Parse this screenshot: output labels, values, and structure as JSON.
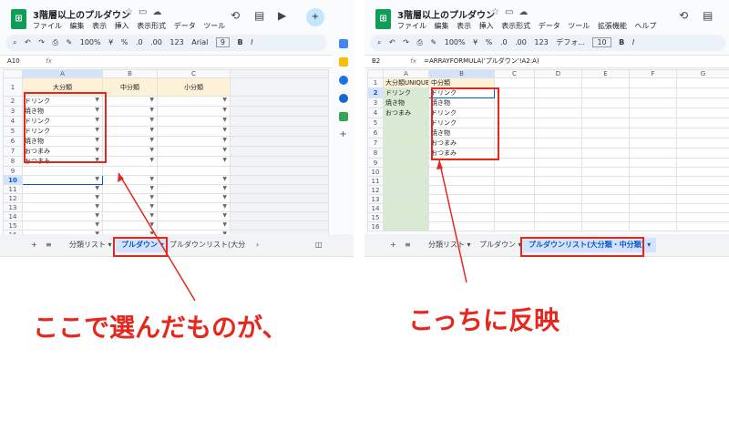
{
  "left": {
    "title": "3階層以上のプルダウン",
    "menu": [
      "ファイル",
      "編集",
      "表示",
      "挿入",
      "表示形式",
      "データ",
      "ツール"
    ],
    "toolbar": [
      "100%",
      "¥",
      "%",
      ".0",
      ".00",
      "123",
      "Arial",
      "9",
      "B",
      "I"
    ],
    "cell_ref": "A10",
    "fx": "fx",
    "columns": [
      "A",
      "B",
      "C"
    ],
    "headers": [
      "大分類",
      "中分類",
      "小分類"
    ],
    "rows": [
      "1",
      "2",
      "3",
      "4",
      "5",
      "6",
      "7",
      "8",
      "9",
      "10",
      "11",
      "12",
      "13",
      "14",
      "15",
      "16"
    ],
    "col_a": [
      "ドリンク",
      "焼き物",
      "ドリンク",
      "ドリンク",
      "焼き物",
      "おつまみ",
      "おつまみ"
    ],
    "tabs": [
      "分類リスト",
      "プルダウン",
      "プルダウンリスト(大分"
    ]
  },
  "right": {
    "title": "3階層以上のプルダウン",
    "menu": [
      "ファイル",
      "編集",
      "表示",
      "挿入",
      "表示形式",
      "データ",
      "ツール",
      "拡張機能",
      "ヘルプ"
    ],
    "toolbar": [
      "100%",
      "¥",
      "%",
      ".0",
      ".00",
      "123",
      "デフォ...",
      "10",
      "B",
      "I"
    ],
    "cell_ref": "B2",
    "fx": "fx",
    "formula": "=ARRAYFORMULA('プルダウン'!A2:A)",
    "columns": [
      "A",
      "B",
      "C",
      "D",
      "E",
      "F",
      "G"
    ],
    "headers": [
      "大分類UNIQUE",
      "中分類"
    ],
    "rows": [
      "1",
      "2",
      "3",
      "4",
      "5",
      "6",
      "7",
      "8",
      "9",
      "10",
      "11",
      "12",
      "13",
      "14",
      "15",
      "16"
    ],
    "col_a": [
      "ドリンク",
      "焼き物",
      "おつまみ"
    ],
    "col_b": [
      "ドリンク",
      "焼き物",
      "ドリンク",
      "ドリンク",
      "焼き物",
      "おつまみ",
      "おつまみ"
    ],
    "tabs": [
      "分類リスト",
      "プルダウン",
      "プルダウンリスト(大分類・中分類)"
    ]
  },
  "captions": {
    "left": "ここで選んだものが、",
    "right": "こっちに反映"
  },
  "colors": {
    "accent": "#e6271e",
    "sheets_green": "#0f9d58",
    "selection": "#0b57d0"
  },
  "icons": [
    "history-icon",
    "comment-icon",
    "meet-icon",
    "share-icon",
    "star-icon",
    "folder-icon",
    "cloud-icon",
    "plus-icon",
    "menu-icon"
  ]
}
